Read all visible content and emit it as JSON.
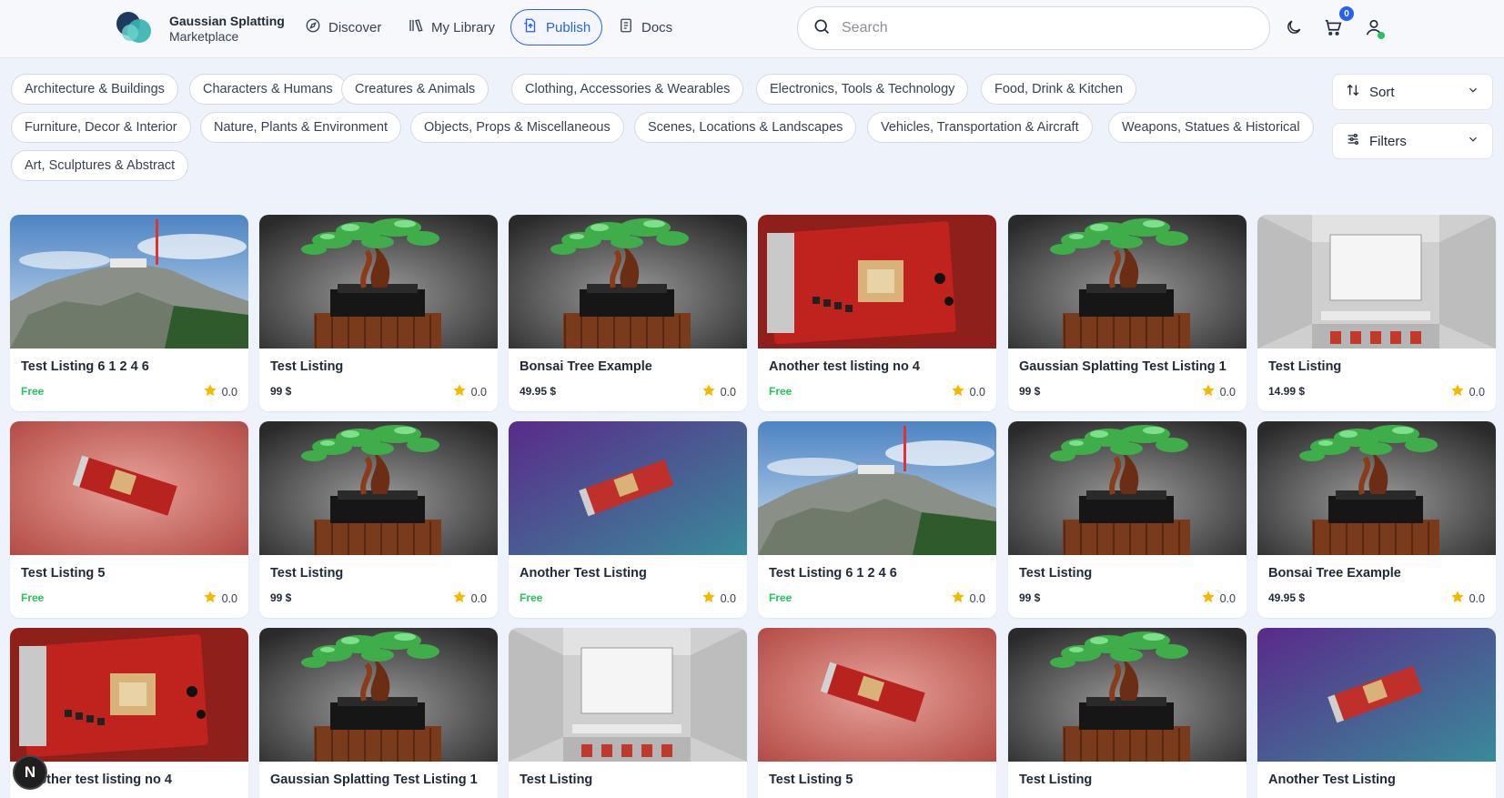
{
  "brand": {
    "line1": "Gaussian Splatting",
    "line2": "Marketplace"
  },
  "nav": [
    {
      "label": "Discover",
      "icon": "compass-icon"
    },
    {
      "label": "My Library",
      "icon": "library-icon"
    },
    {
      "label": "Publish",
      "icon": "publish-icon",
      "active": true
    },
    {
      "label": "Docs",
      "icon": "document-icon"
    }
  ],
  "search": {
    "placeholder": "Search",
    "value": ""
  },
  "cart": {
    "count": "0"
  },
  "categories": [
    "Architecture & Buildings",
    "Characters & Humans",
    "Creatures & Animals",
    "Clothing, Accessories & Wearables",
    "Electronics, Tools & Technology",
    "Food, Drink & Kitchen",
    "Furniture, Decor & Interior",
    "Nature, Plants & Environment",
    "Objects, Props & Miscellaneous",
    "Scenes, Locations & Landscapes",
    "Vehicles, Transportation & Aircraft",
    "Weapons, Statues & Historical",
    "Art, Sculptures & Abstract"
  ],
  "sort": {
    "label": "Sort"
  },
  "filters": {
    "label": "Filters"
  },
  "listings": [
    {
      "title": "Test Listing 6 1 2 4 6",
      "price": "Free",
      "rating": "0.0",
      "thumb": "mountain"
    },
    {
      "title": "Test Listing",
      "price": "99 $",
      "rating": "0.0",
      "thumb": "bonsai"
    },
    {
      "title": "Bonsai Tree Example",
      "price": "49.95 $",
      "rating": "0.0",
      "thumb": "bonsai"
    },
    {
      "title": "Another test listing no 4",
      "price": "Free",
      "rating": "0.0",
      "thumb": "gpu-closeup"
    },
    {
      "title": "Gaussian Splatting Test Listing 1",
      "price": "99 $",
      "rating": "0.0",
      "thumb": "bonsai"
    },
    {
      "title": "Test Listing",
      "price": "14.99 $",
      "rating": "0.0",
      "thumb": "room"
    },
    {
      "title": "Test Listing 5",
      "price": "Free",
      "rating": "0.0",
      "thumb": "gpu-red"
    },
    {
      "title": "Test Listing",
      "price": "99 $",
      "rating": "0.0",
      "thumb": "bonsai"
    },
    {
      "title": "Another Test Listing",
      "price": "Free",
      "rating": "0.0",
      "thumb": "gpu-purple"
    },
    {
      "title": "Test Listing 6 1 2 4 6",
      "price": "Free",
      "rating": "0.0",
      "thumb": "mountain"
    },
    {
      "title": "Test Listing",
      "price": "99 $",
      "rating": "0.0",
      "thumb": "bonsai"
    },
    {
      "title": "Bonsai Tree Example",
      "price": "49.95 $",
      "rating": "0.0",
      "thumb": "bonsai"
    },
    {
      "title": "Another test listing no 4",
      "price": "",
      "rating": "",
      "thumb": "gpu-closeup"
    },
    {
      "title": "Gaussian Splatting Test Listing 1",
      "price": "",
      "rating": "",
      "thumb": "bonsai"
    },
    {
      "title": "Test Listing",
      "price": "",
      "rating": "",
      "thumb": "room"
    },
    {
      "title": "Test Listing 5",
      "price": "",
      "rating": "",
      "thumb": "gpu-red"
    },
    {
      "title": "Test Listing",
      "price": "",
      "rating": "",
      "thumb": "bonsai"
    },
    {
      "title": "Another Test Listing",
      "price": "",
      "rating": "",
      "thumb": "gpu-purple"
    }
  ],
  "floating_badge": {
    "label": "N"
  },
  "colors": {
    "accent": "#2563eb",
    "free": "#22c55e",
    "star": "#f5b800"
  }
}
